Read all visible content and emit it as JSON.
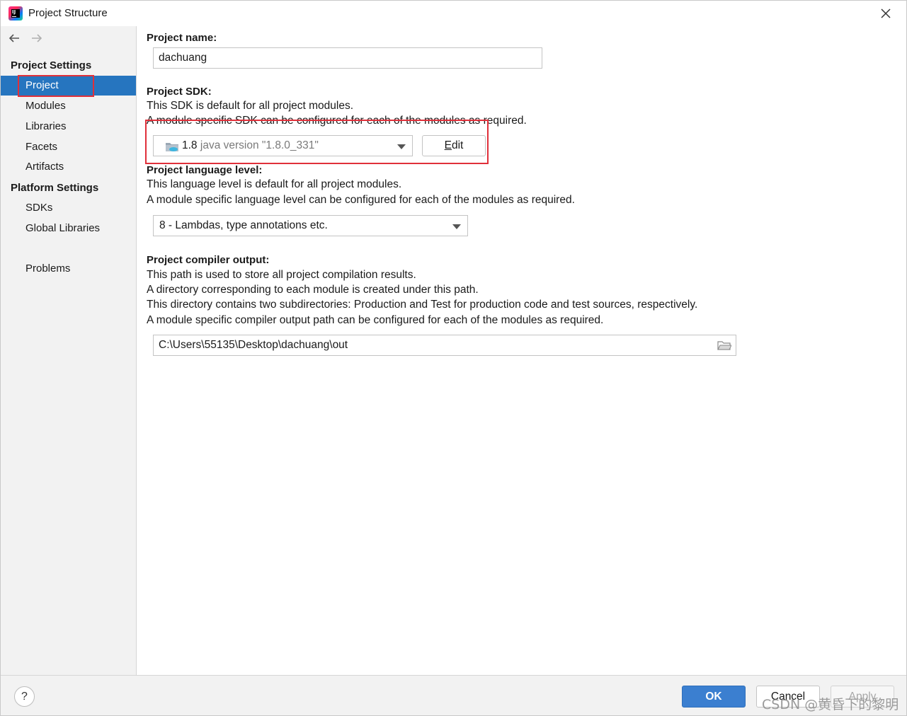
{
  "window": {
    "title": "Project Structure"
  },
  "sidebar": {
    "project_settings_header": "Project Settings",
    "project_settings_items": [
      {
        "label": "Project",
        "selected": true
      },
      {
        "label": "Modules"
      },
      {
        "label": "Libraries"
      },
      {
        "label": "Facets"
      },
      {
        "label": "Artifacts"
      }
    ],
    "platform_settings_header": "Platform Settings",
    "platform_settings_items": [
      {
        "label": "SDKs"
      },
      {
        "label": "Global Libraries"
      }
    ],
    "problems_label": "Problems"
  },
  "project_name": {
    "label": "Project name:",
    "value": "dachuang"
  },
  "project_sdk": {
    "label": "Project SDK:",
    "desc_1": "This SDK is default for all project modules.",
    "desc_2": "A module specific SDK can be configured for each of the modules as required.",
    "selected_version": "1.8",
    "selected_detail": "java version \"1.8.0_331\"",
    "edit_prefix": "",
    "edit_mnemonic": "E",
    "edit_rest": "dit"
  },
  "language_level": {
    "label": "Project language level:",
    "desc_1": "This language level is default for all project modules.",
    "desc_2": "A module specific language level can be configured for each of the modules as required.",
    "selected": "8 - Lambdas, type annotations etc."
  },
  "compiler_output": {
    "label": "Project compiler output:",
    "desc_1": "This path is used to store all project compilation results.",
    "desc_2": "A directory corresponding to each module is created under this path.",
    "desc_3": "This directory contains two subdirectories: Production and Test for production code and test sources, respectively.",
    "desc_4": "A module specific compiler output path can be configured for each of the modules as required.",
    "path": "C:\\Users\\55135\\Desktop\\dachuang\\out"
  },
  "buttons": {
    "help": "?",
    "ok": "OK",
    "cancel": "Cancel",
    "apply": "Apply"
  },
  "watermark": "CSDN @黄昏下的黎明",
  "colors": {
    "selection": "#2675bf",
    "highlight_box": "#e0303a",
    "ok_button": "#3b7fd0"
  },
  "icons": {
    "back": "arrow-left-icon",
    "forward": "arrow-right-icon",
    "close": "close-icon",
    "sdk": "jdk-folder-icon",
    "browse": "folder-icon",
    "logo": "intellij-logo-icon"
  }
}
